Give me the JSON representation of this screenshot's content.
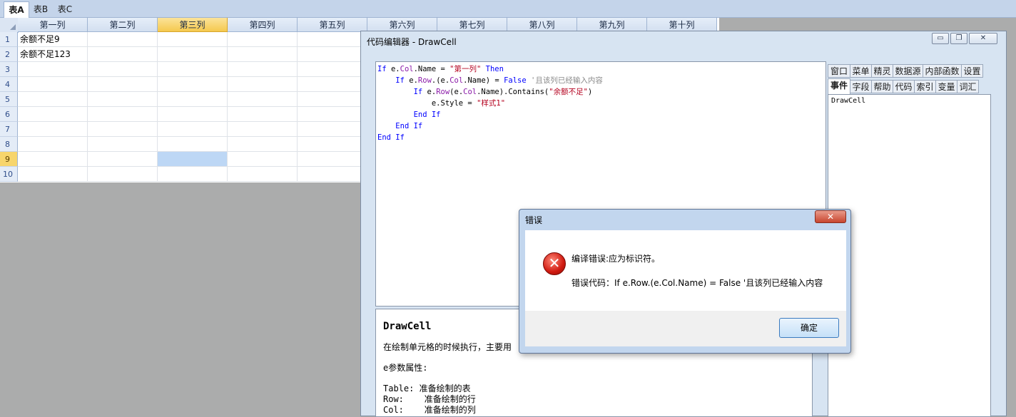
{
  "sheet_tabs": [
    "表A",
    "表B",
    "表C"
  ],
  "grid": {
    "columns": [
      "第一列",
      "第二列",
      "第三列",
      "第四列",
      "第五列",
      "第六列",
      "第七列",
      "第八列",
      "第九列",
      "第十列"
    ],
    "rows": [
      "1",
      "2",
      "3",
      "4",
      "5",
      "6",
      "7",
      "8",
      "9",
      "10"
    ],
    "cells": {
      "r1c1": "余额不足9",
      "r2c1": "余额不足123"
    }
  },
  "editor": {
    "title": "代码编辑器 - DrawCell",
    "window_buttons": {
      "minimize": "▭",
      "restore": "❐",
      "close": "✕"
    },
    "side_tabs_row1": [
      "窗口",
      "菜单",
      "精灵",
      "数据源",
      "内部函数",
      "设置"
    ],
    "side_tabs_row2": [
      "事件",
      "字段",
      "帮助",
      "代码",
      "索引",
      "变量",
      "词汇"
    ],
    "side_panel_item": "DrawCell",
    "help": {
      "title": "DrawCell",
      "desc": "在绘制单元格的时候执行，主要用",
      "params_header": "e参数属性:",
      "table": "Table: 准备绘制的表",
      "row": "Row:    准备绘制的行",
      "col": "Col:    准备绘制的列"
    }
  },
  "dialog": {
    "title": "错误",
    "close_label": "✕",
    "message": "编译错误:应为标识符。",
    "code_line": "错误代码：If e.Row.(e.Col.Name) = False '且该列已经输入内容",
    "ok_label": "确定",
    "icon_glyph": "✕"
  },
  "colors": {
    "error_red": "#d01a10",
    "selected_header": "#f5c94e",
    "selected_cell": "#bdd7f5"
  }
}
